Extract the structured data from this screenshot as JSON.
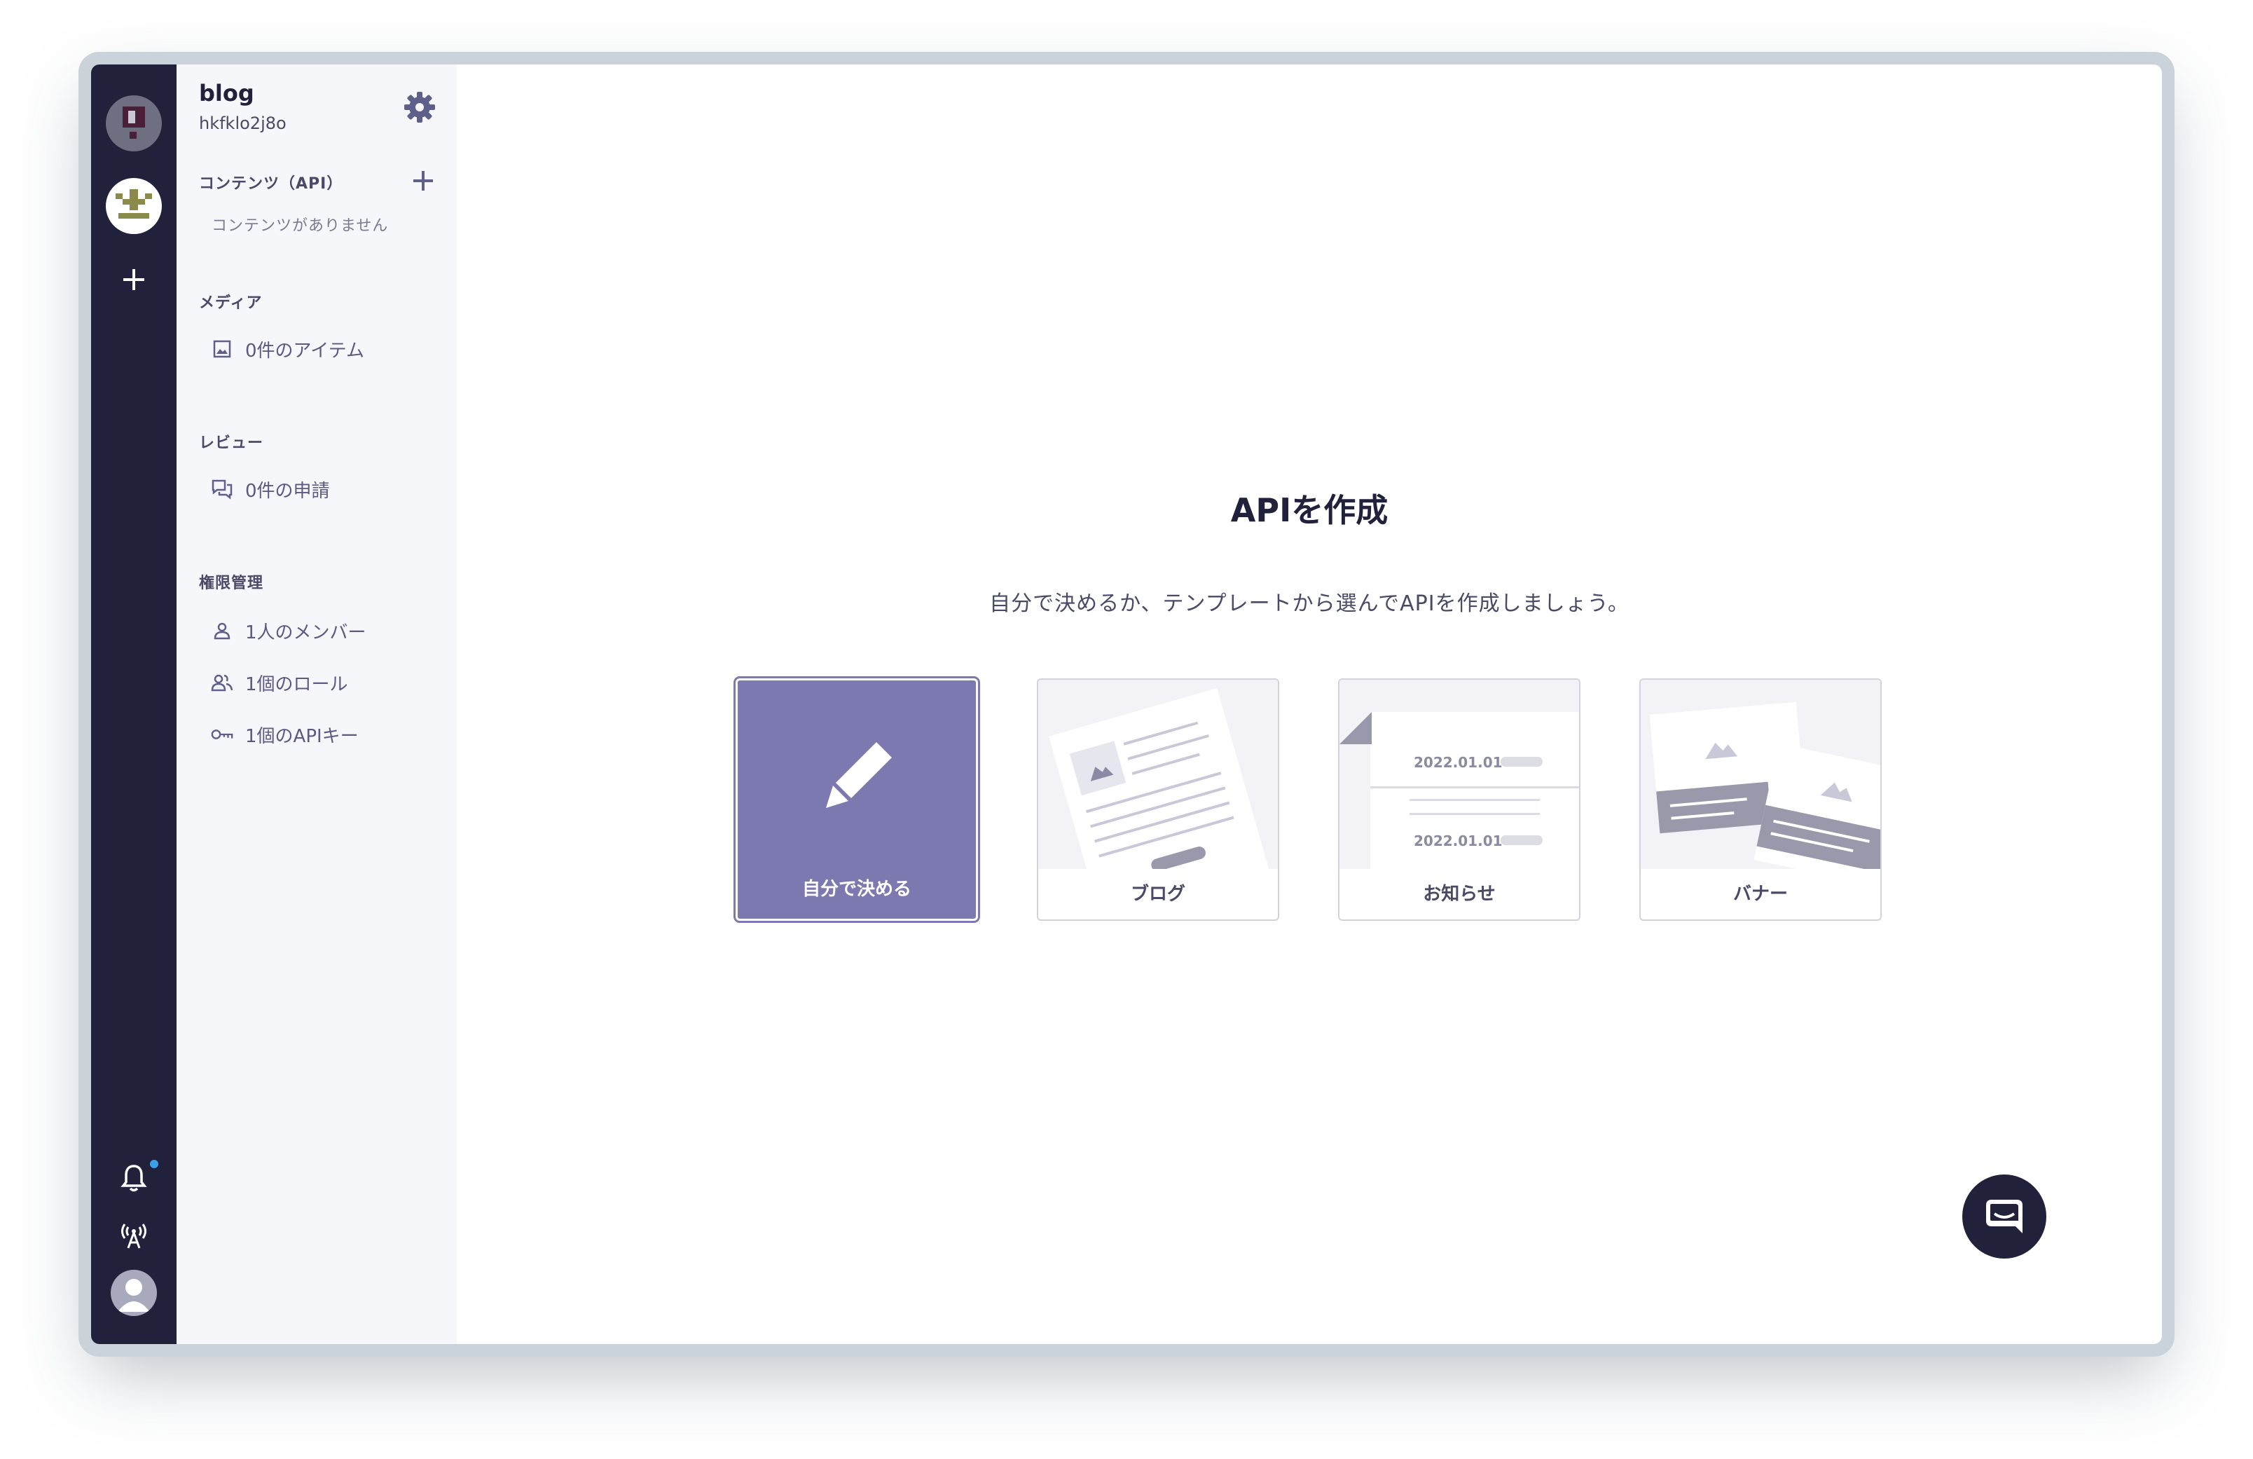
{
  "service": {
    "name": "blog",
    "id": "hkfklo2j8o"
  },
  "sidebar": {
    "contents": {
      "title": "コンテンツ（API）",
      "empty": "コンテンツがありません"
    },
    "media": {
      "title": "メディア",
      "items": [
        {
          "label": "0件のアイテム",
          "icon": "image-icon"
        }
      ]
    },
    "review": {
      "title": "レビュー",
      "items": [
        {
          "label": "0件の申請",
          "icon": "review-icon"
        }
      ]
    },
    "permissions": {
      "title": "権限管理",
      "items": [
        {
          "label": "1人のメンバー",
          "icon": "member-icon"
        },
        {
          "label": "1個のロール",
          "icon": "role-icon"
        },
        {
          "label": "1個のAPIキー",
          "icon": "key-icon"
        }
      ]
    }
  },
  "main": {
    "title": "APIを作成",
    "description": "自分で決めるか、テンプレートから選んでAPIを作成しましょう。",
    "cards": [
      {
        "label": "自分で決める",
        "selected": true
      },
      {
        "label": "ブログ",
        "selected": false
      },
      {
        "label": "お知らせ",
        "selected": false,
        "dates": [
          "2022.01.01",
          "2022.01.01"
        ]
      },
      {
        "label": "バナー",
        "selected": false
      }
    ]
  },
  "colors": {
    "rail": "#21213b",
    "sidebar": "#f6f7fb",
    "accent": "#7b79b0",
    "notification_dot": "#3aa0e6"
  }
}
